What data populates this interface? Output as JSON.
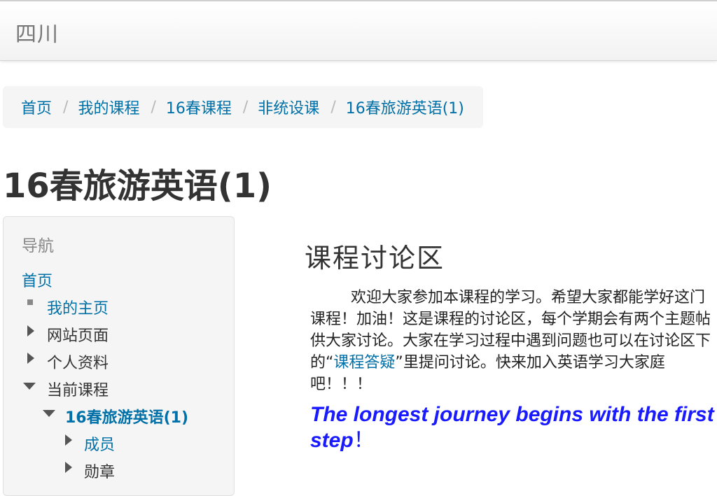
{
  "header": {
    "site_name": "四川"
  },
  "breadcrumb": {
    "items": [
      "首页",
      "我的课程",
      "16春课程",
      "非统设课",
      "16春旅游英语(1)"
    ],
    "separator": "/"
  },
  "page": {
    "title": "16春旅游英语(1)"
  },
  "navigation": {
    "heading": "导航",
    "items": [
      {
        "label": "首页"
      },
      {
        "label": "我的主页"
      },
      {
        "label": "网站页面"
      },
      {
        "label": "个人资料"
      },
      {
        "label": "当前课程"
      },
      {
        "label": "16春旅游英语(1)"
      },
      {
        "label": "成员"
      },
      {
        "label": "勋章"
      }
    ]
  },
  "main": {
    "section_title": "课程讨论区",
    "summary_before_link": "欢迎大家参加本课程的学习。希望大家都能学好这门课程！加油！这是课程的讨论区，每个学期会有两个主题帖供大家讨论。大家在学习过程中遇到问题也可以在讨论区下的“",
    "summary_link": "课程答疑",
    "summary_after_link": "”里提问讨论。快来加入英语学习大家庭吧！！！",
    "quote": "The longest journey begins with the first step",
    "quote_end": "！"
  },
  "colors": {
    "link": "#0070a8",
    "quote": "#1a1aff",
    "breadcrumb_bg": "#f5f5f5"
  }
}
